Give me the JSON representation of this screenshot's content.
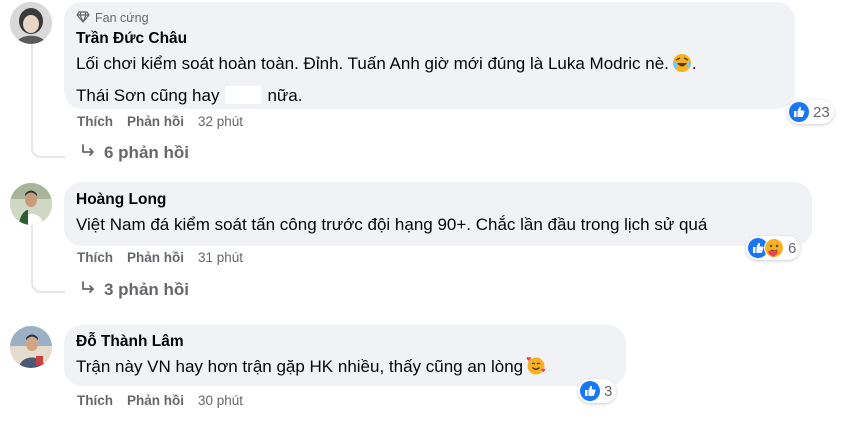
{
  "comments": [
    {
      "author": "Trần Đức Châu",
      "badge": "Fan cứng",
      "text_line1": "Lối chơi kiểm soát hoàn toàn. Đỉnh. Tuấn Anh giờ mới đúng là Luka Modric nè.",
      "text_line1_end": ".",
      "text_line2_a": "Thái Sơn cũng hay",
      "text_line2_b": "nữa.",
      "like_label": "Thích",
      "reply_label": "Phản hồi",
      "time": "32 phút",
      "reaction_count": "23",
      "replies_label": "6 phản hồi",
      "reactions": [
        "like-icon"
      ],
      "inline_emoji": "rofl-emoji"
    },
    {
      "author": "Hoàng Long",
      "text": "Việt Nam đá kiểm soát tấn công trước đội hạng 90+. Chắc lần đầu trong lịch sử quá",
      "like_label": "Thích",
      "reply_label": "Phản hồi",
      "time": "31 phút",
      "reaction_count": "6",
      "replies_label": "3 phản hồi",
      "reactions": [
        "like-icon",
        "care-icon"
      ]
    },
    {
      "author": "Đỗ Thành Lâm",
      "text": "Trận này VN hay hơn trận gặp HK nhiều, thấy cũng an lòng",
      "like_label": "Thích",
      "reply_label": "Phản hồi",
      "time": "30 phút",
      "reaction_count": "3",
      "reactions": [
        "like-icon"
      ],
      "inline_emoji": "smiling-face-with-hearts-emoji"
    }
  ],
  "colors": {
    "bubble": "#f0f2f5",
    "secondary_text": "#65676b",
    "like_blue": "#1877f2",
    "care_yellow": "#f7b125"
  }
}
